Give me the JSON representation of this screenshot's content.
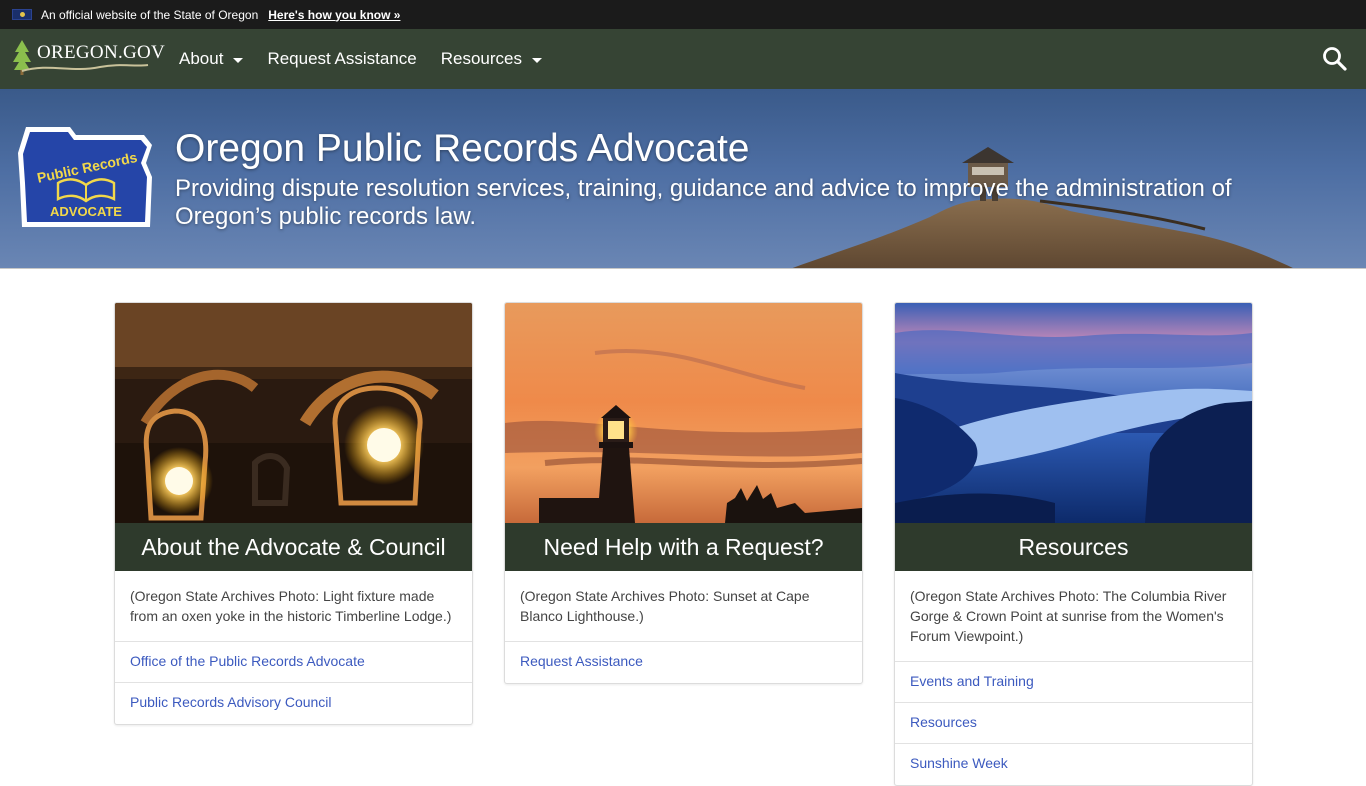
{
  "official_banner": {
    "text": "An official website of the State of Oregon",
    "link": "Here's how you know »"
  },
  "navbar": {
    "brand": "OREGON.GOV",
    "items": [
      {
        "label": "About",
        "has_dropdown": true
      },
      {
        "label": "Request Assistance",
        "has_dropdown": false
      },
      {
        "label": "Resources",
        "has_dropdown": true
      }
    ],
    "search_icon": "search-icon"
  },
  "hero": {
    "logo_top": "Public Records",
    "logo_bottom": "ADVOCATE",
    "title": "Oregon Public Records Advocate",
    "subtitle": "Providing dispute resolution services, training, guidance and advice to improve the administration of Oregon’s public records law."
  },
  "cards": [
    {
      "title": "About the Advocate & Council",
      "caption": "(Oregon State Archives Photo: Light fixture made from an oxen yoke in the historic Timberline Lodge.)",
      "links": [
        "Office of the Public Records Advocate",
        "Public Records Advisory Council"
      ]
    },
    {
      "title": "Need Help with a Request?",
      "caption": "(Oregon State Archives Photo: Sunset at Cape Blanco Lighthouse.)",
      "links": [
        "Request Assistance"
      ]
    },
    {
      "title": "Resources",
      "caption": "(Oregon State Archives Photo: The Columbia River Gorge & Crown Point at sunrise from the Women's Forum Viewpoint.)",
      "links": [
        "Events and Training",
        "Resources",
        "Sunshine Week"
      ]
    }
  ],
  "colors": {
    "top_bar": "#1b1b1b",
    "navbar": "#364434",
    "card_title_bar": "#2e3a2c",
    "link": "#3c5abf"
  }
}
